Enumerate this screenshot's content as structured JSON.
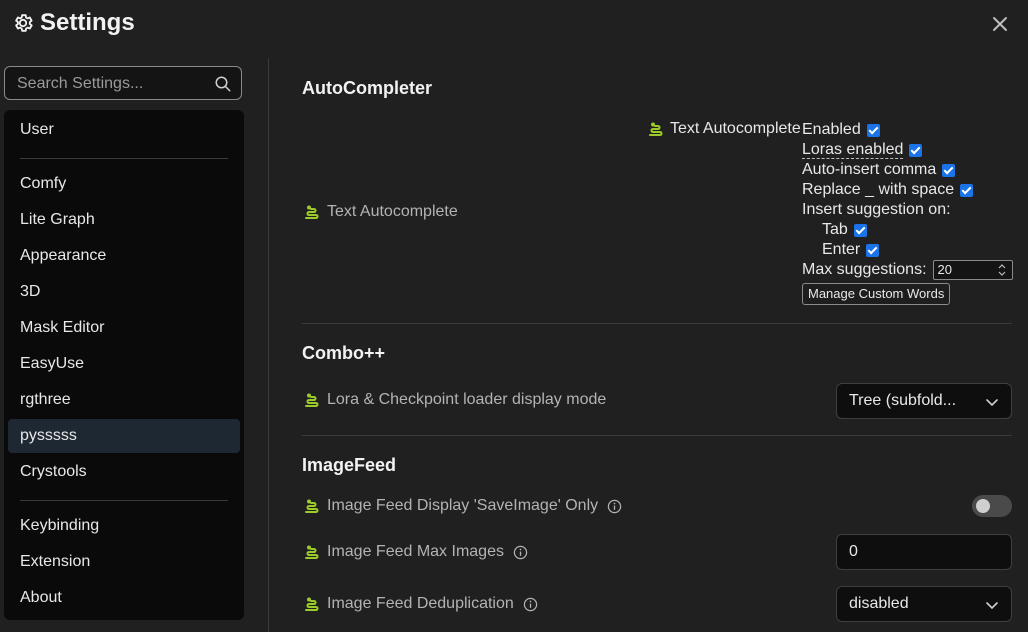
{
  "header": {
    "title": "Settings"
  },
  "search": {
    "placeholder": "Search Settings..."
  },
  "sidebar": {
    "items": [
      {
        "label": "User"
      },
      {
        "label": "Comfy"
      },
      {
        "label": "Lite Graph"
      },
      {
        "label": "Appearance"
      },
      {
        "label": "3D"
      },
      {
        "label": "Mask Editor"
      },
      {
        "label": "EasyUse"
      },
      {
        "label": "rgthree"
      },
      {
        "label": "pysssss",
        "active": true
      },
      {
        "label": "Crystools"
      },
      {
        "label": "Keybinding"
      },
      {
        "label": "Extension"
      },
      {
        "label": "About"
      }
    ]
  },
  "sections": {
    "autocompleter": {
      "title": "AutoCompleter",
      "row_label": "Text Autocomplete",
      "panel": {
        "heading": "Text Autocomplete",
        "enabled": "Enabled",
        "loras_enabled": "Loras enabled",
        "auto_insert_comma": "Auto-insert comma",
        "replace_underscore": "Replace _ with space",
        "insert_on": "Insert suggestion on:",
        "tab": "Tab",
        "enter": "Enter",
        "max_suggestions_label": "Max suggestions:",
        "max_suggestions_value": "20",
        "manage_button": "Manage Custom Words"
      }
    },
    "combo": {
      "title": "Combo++",
      "row_label": "Lora & Checkpoint loader display mode",
      "select_value": "Tree (subfold..."
    },
    "imagefeed": {
      "title": "ImageFeed",
      "display_label": "Image Feed Display 'SaveImage' Only",
      "display_toggle": false,
      "max_images_label": "Image Feed Max Images",
      "max_images_value": "0",
      "dedup_label": "Image Feed Deduplication",
      "dedup_value": "disabled"
    }
  },
  "colors": {
    "accent": "#1a73e8",
    "snake": "#9ccc2a",
    "background": "#202020",
    "sidebar": "#0a0a0a"
  },
  "icons": [
    "gear-icon",
    "close-icon",
    "search-icon",
    "snake-icon",
    "info-icon",
    "chevron-down-icon"
  ]
}
